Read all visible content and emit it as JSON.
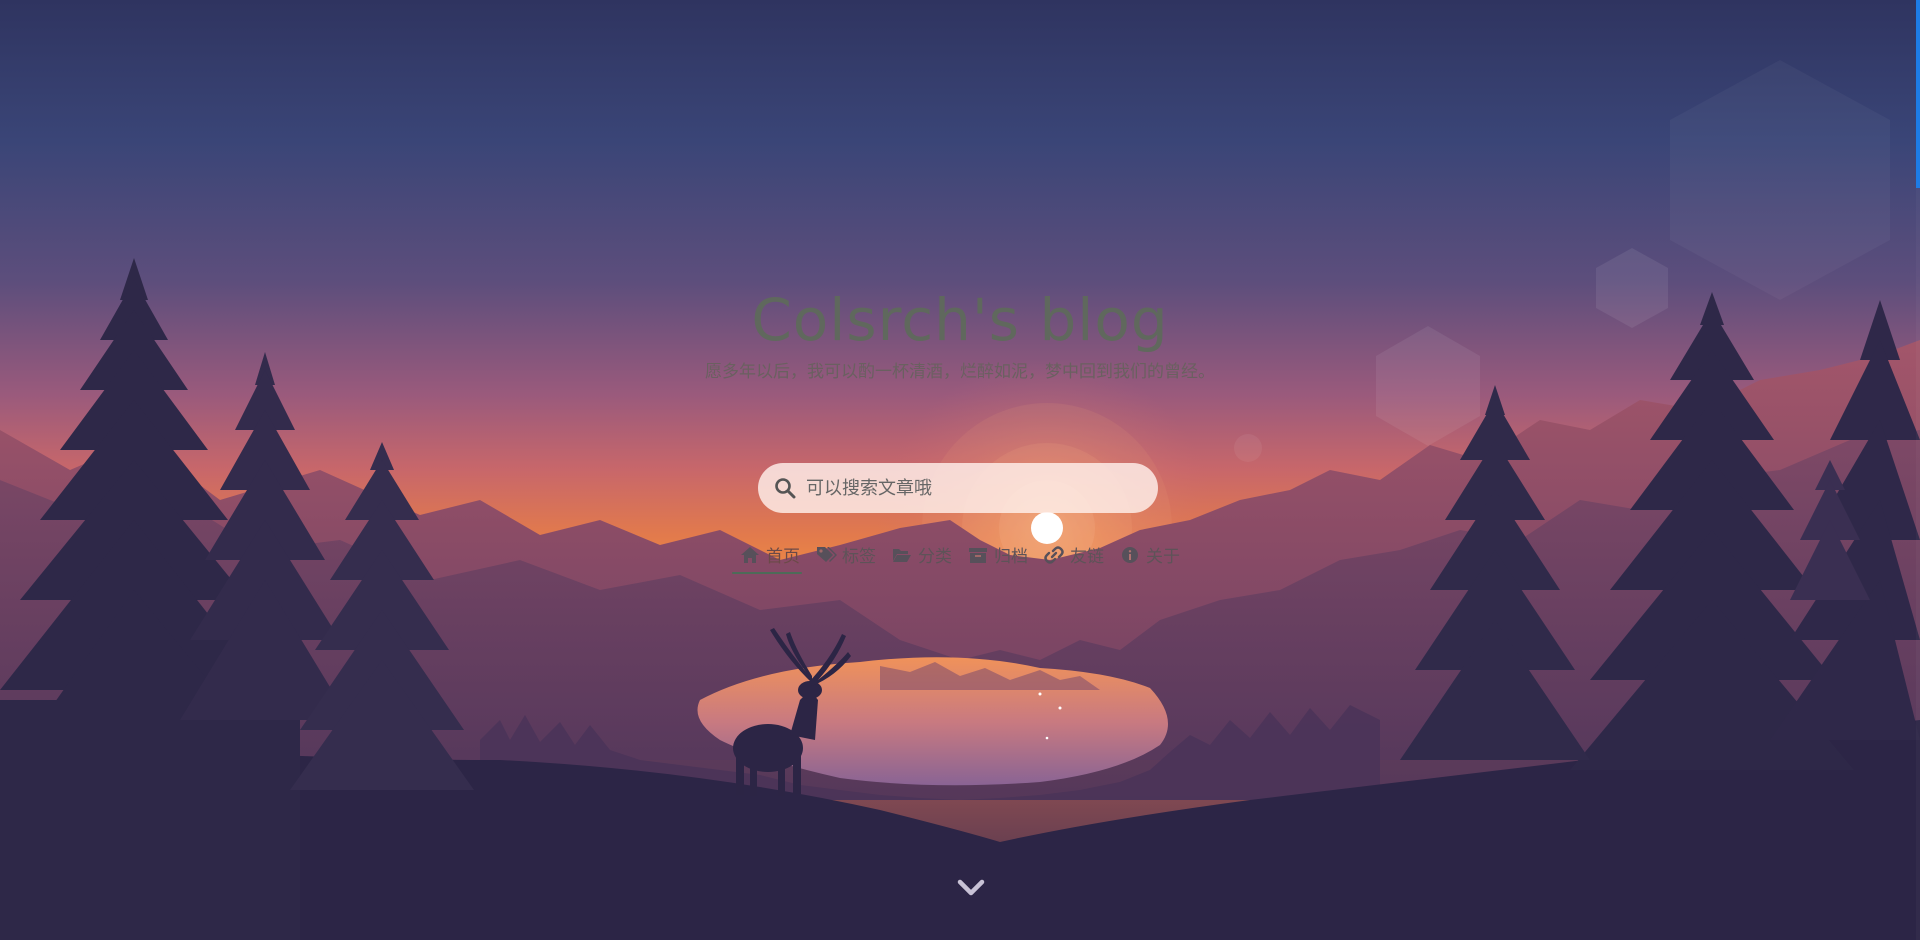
{
  "site": {
    "title": "Colsrch's blog",
    "subtitle": "愿多年以后，我可以酌一杯清酒，烂醉如泥，梦中回到我们的曾经。"
  },
  "search": {
    "placeholder": "可以搜索文章哦",
    "value": "",
    "icon": "search-icon"
  },
  "nav": {
    "items": [
      {
        "label": "首页",
        "icon": "home-icon",
        "active": true
      },
      {
        "label": "标签",
        "icon": "tags-icon",
        "active": false
      },
      {
        "label": "分类",
        "icon": "folder-open-icon",
        "active": false
      },
      {
        "label": "归档",
        "icon": "archive-icon",
        "active": false
      },
      {
        "label": "友链",
        "icon": "link-icon",
        "active": false
      },
      {
        "label": "关于",
        "icon": "info-icon",
        "active": false
      }
    ]
  },
  "scroll_down_icon": "chevron-down-icon",
  "colors": {
    "sky_top": "#2e3562",
    "sky_mid": "#6b4e7a",
    "horizon": "#e8853e",
    "sun": "#ffffff",
    "mountain_far": "#8a4f6a",
    "mountain_mid": "#6a3d5e",
    "lake": "#d48470",
    "foreground": "#2b2444",
    "trees": "#2f2848",
    "accent_scroll": "#1d7ce6",
    "title": "#5f6a5c",
    "nav_underline": "#4d6b58"
  }
}
